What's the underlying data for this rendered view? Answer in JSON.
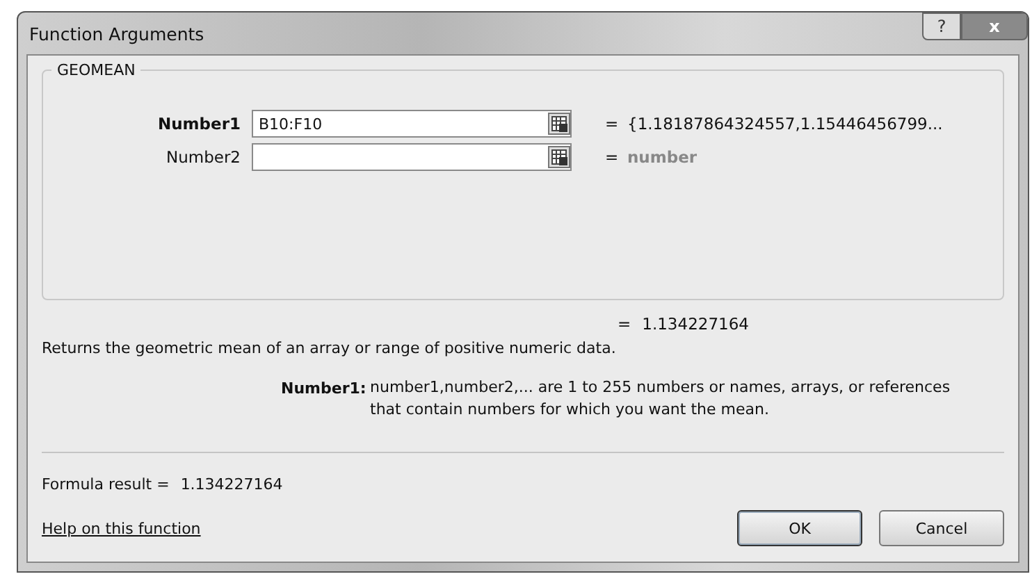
{
  "window": {
    "title": "Function Arguments",
    "help_glyph": "?",
    "close_glyph": "x"
  },
  "function": {
    "name": "GEOMEAN",
    "arguments": [
      {
        "label": "Number1",
        "required": true,
        "value": "B10:F10",
        "result": "{1.18187864324557,1.15446456799...",
        "result_hint": false
      },
      {
        "label": "Number2",
        "required": false,
        "result": "number",
        "result_hint": true
      }
    ]
  },
  "equals_sign": "=",
  "result": "1.134227164",
  "description": "Returns the geometric mean of an array or range of positive numeric data.",
  "argument_help": {
    "label": "Number1:",
    "text": "number1,number2,... are 1 to 255 numbers or names, arrays, or references that contain numbers for which you want the mean."
  },
  "formula_result": {
    "label": "Formula result =",
    "value": "1.134227164"
  },
  "help_link": "Help on this function",
  "buttons": [
    {
      "label": "OK",
      "default": true
    },
    {
      "label": "Cancel",
      "default": false
    }
  ]
}
